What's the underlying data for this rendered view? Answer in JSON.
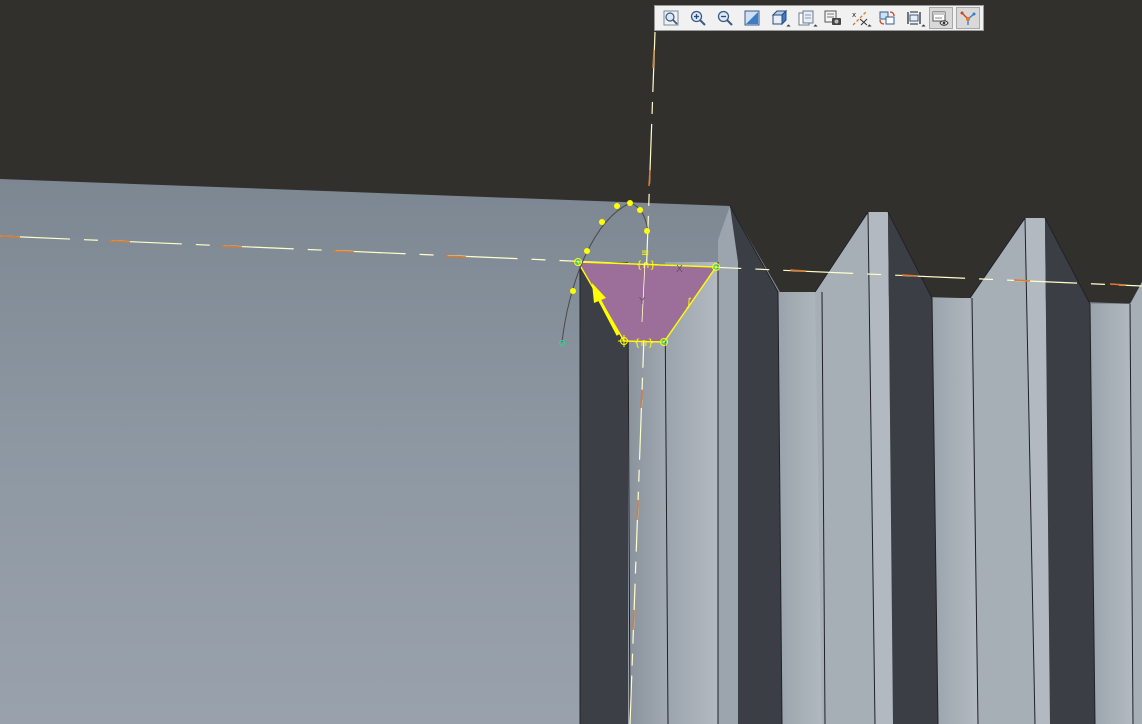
{
  "viewport": {
    "background_color": "#31302d",
    "part_surface_color": "#8f99a4",
    "groove_shadow_color": "#3d4046",
    "sketch_fill_color": "#9b6f99",
    "sketch_line_color": "#ffff00",
    "centerline_color": "#ffffcc",
    "centerline_accent_color": "#e07a2a",
    "constraint_symbols": {
      "horizontal_top": "{∩}",
      "horizontal_bottom": "{∩}",
      "slant": "∫",
      "top_marker": "≡",
      "axis_x": "X",
      "axis_y": "Y"
    }
  },
  "toolbar": {
    "buttons": [
      {
        "name": "zoom-fit-icon",
        "active": false,
        "dropdown": false
      },
      {
        "name": "zoom-in-icon",
        "active": false,
        "dropdown": false
      },
      {
        "name": "zoom-out-icon",
        "active": false,
        "dropdown": false
      },
      {
        "name": "normal-view-icon",
        "active": false,
        "dropdown": false
      },
      {
        "name": "view-orientation-cube-icon",
        "active": false,
        "dropdown": true
      },
      {
        "name": "display-style-icon",
        "active": false,
        "dropdown": true
      },
      {
        "name": "saved-views-camera-icon",
        "active": false,
        "dropdown": false
      },
      {
        "name": "datum-display-icon",
        "active": false,
        "dropdown": true
      },
      {
        "name": "refit-icon",
        "active": false,
        "dropdown": false
      },
      {
        "name": "sketch-settings-icon",
        "active": false,
        "dropdown": true
      },
      {
        "name": "sketcher-display-icon",
        "active": true,
        "dropdown": false
      },
      {
        "name": "constraints-display-icon",
        "active": true,
        "dropdown": false
      }
    ]
  }
}
